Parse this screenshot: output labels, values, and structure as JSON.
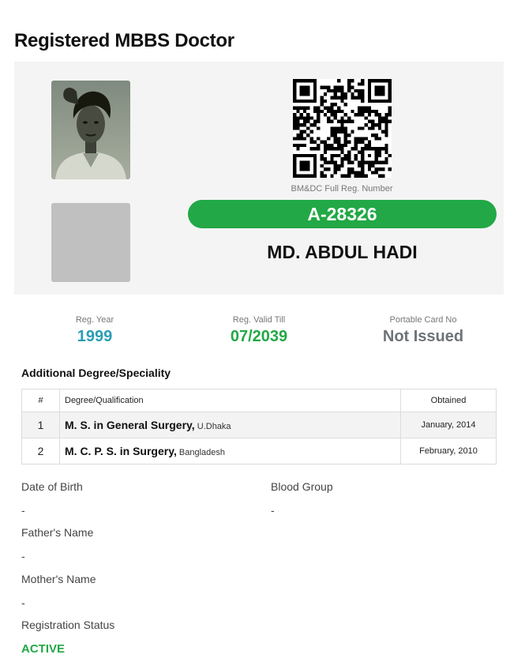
{
  "page": {
    "title": "Registered MBBS Doctor"
  },
  "card": {
    "qr_caption": "BM&DC Full Reg. Number",
    "reg_number": "A-28326",
    "doctor_name": "MD. ABDUL HADI",
    "colors": {
      "card_bg": "#f4f4f4",
      "pill": "#22a846"
    }
  },
  "stats": [
    {
      "label": "Reg. Year",
      "value": "1999",
      "color": "#2a9db4"
    },
    {
      "label": "Reg. Valid Till",
      "value": "07/2039",
      "color": "#22a846"
    },
    {
      "label": "Portable Card No",
      "value": "Not Issued",
      "color": "#6d7377"
    }
  ],
  "degrees": {
    "title": "Additional Degree/Speciality",
    "headers": {
      "num": "#",
      "degree": "Degree/Qualification",
      "obtained": "Obtained"
    },
    "rows": [
      {
        "num": "1",
        "degree": "M. S. in General Surgery,",
        "institute": "U.Dhaka",
        "obtained": "January, 2014"
      },
      {
        "num": "2",
        "degree": "M. C. P. S. in Surgery,",
        "institute": "Bangladesh",
        "obtained": "February, 2010"
      }
    ]
  },
  "details": {
    "dob": {
      "label": "Date of Birth",
      "value": "-"
    },
    "blood_group": {
      "label": "Blood Group",
      "value": "-"
    },
    "father": {
      "label": "Father's Name",
      "value": "-"
    },
    "mother": {
      "label": "Mother's Name",
      "value": "-"
    },
    "status": {
      "label": "Registration Status",
      "value": "ACTIVE",
      "color": "#22a846"
    }
  }
}
